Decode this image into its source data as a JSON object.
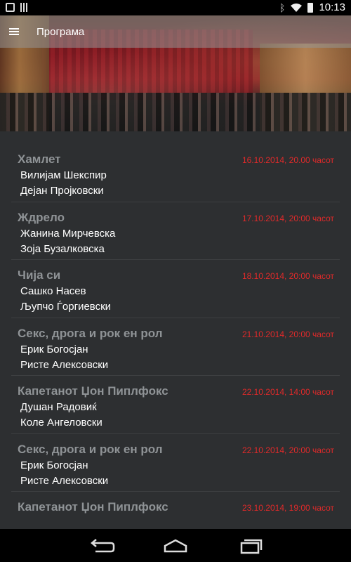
{
  "status_bar": {
    "time": "10:13",
    "icons": [
      "notification-icon",
      "sim-icon",
      "bluetooth-icon",
      "wifi-icon",
      "battery-icon"
    ]
  },
  "app_bar": {
    "title": "Програма",
    "menu_icon": "hamburger-menu-icon"
  },
  "colors": {
    "title": "#8f9396",
    "date": "#e02a2a",
    "text": "#ffffff",
    "background": "#2d2f31"
  },
  "events": [
    {
      "title": "Хамлет",
      "date": "16.10.2014, 20.00 часот",
      "line1": "Вилијам Шекспир",
      "line2": "Дејан Пројковски"
    },
    {
      "title": "Ждрело",
      "date": "17.10.2014, 20:00 часот",
      "line1": "Жанина Мирчевска",
      "line2": "Зоја Бузалковска"
    },
    {
      "title": "Чија си",
      "date": "18.10.2014, 20:00 часот",
      "line1": "Сашко Насев",
      "line2": "Љупчо Ѓоргиевски"
    },
    {
      "title": "Секс, дрога и рок ен рол",
      "date": "21.10.2014, 20:00 часот",
      "line1": "Ерик Богосјан",
      "line2": "Ристе Алексовски"
    },
    {
      "title": "Капетанот Џон Пиплфокс",
      "date": "22.10.2014, 14:00 часот",
      "line1": "Душан Радовиќ",
      "line2": "Коле Ангеловски"
    },
    {
      "title": "Секс, дрога и рок ен рол",
      "date": "22.10.2014, 20:00 часот",
      "line1": "Ерик Богосјан",
      "line2": "Ристе Алексовски"
    },
    {
      "title": "Капетанот Џон Пиплфокс",
      "date": "23.10.2014, 19:00 часот",
      "line1": "",
      "line2": ""
    }
  ],
  "nav_bar": {
    "back_icon": "back-icon",
    "home_icon": "home-icon",
    "recents_icon": "recents-icon"
  }
}
